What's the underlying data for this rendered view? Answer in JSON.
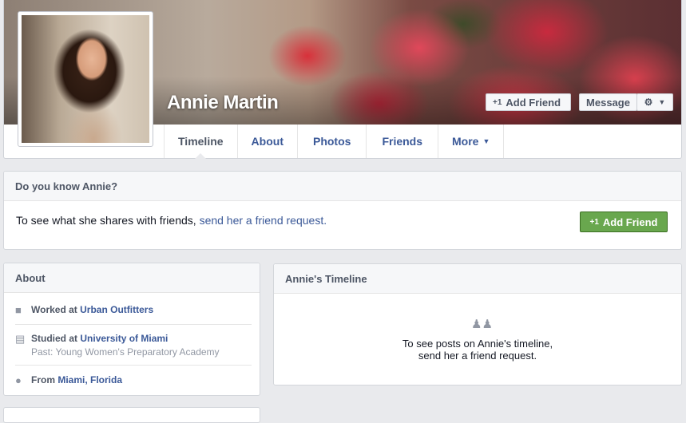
{
  "profile": {
    "name": "Annie Martin",
    "actions": {
      "add_friend": "Add Friend",
      "message": "Message"
    }
  },
  "tabs": [
    {
      "label": "Timeline",
      "active": true
    },
    {
      "label": "About"
    },
    {
      "label": "Photos"
    },
    {
      "label": "Friends"
    },
    {
      "label": "More"
    }
  ],
  "know_card": {
    "title": "Do you know Annie?",
    "text": "To see what she shares with friends,",
    "link": "send her a friend request.",
    "button": "Add Friend"
  },
  "about": {
    "title": "About",
    "items": [
      {
        "icon": "briefcase-icon",
        "prefix": "Worked at",
        "value": "Urban Outfitters"
      },
      {
        "icon": "school-icon",
        "prefix": "Studied at",
        "value": "University of Miami",
        "sub": "Past: Young Women's Preparatory Academy"
      },
      {
        "icon": "location-pin-icon",
        "prefix": "From",
        "value": "Miami, Florida"
      }
    ]
  },
  "timeline": {
    "title": "Annie's Timeline",
    "line1": "To see posts on Annie's timeline,",
    "line2": "send her a friend request."
  },
  "colors": {
    "link": "#3b5998",
    "green_button": "#69a74e",
    "background": "#e9eaed"
  }
}
